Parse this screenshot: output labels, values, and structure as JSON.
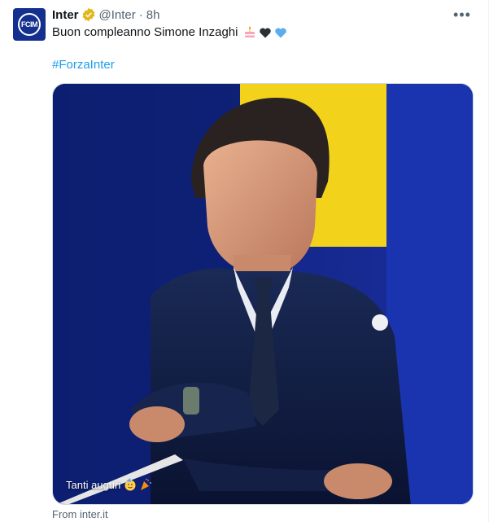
{
  "account": {
    "name": "Inter",
    "handle": "@Inter",
    "separator": "·",
    "time": "8h",
    "avatar_text": "FCIM"
  },
  "tweet": {
    "text": "Buon compleanno Simone Inzaghi",
    "hashtag": "#ForzaInter",
    "emojis": [
      "birthday-cake-icon",
      "black-heart-icon",
      "blue-heart-icon"
    ]
  },
  "media": {
    "caption": "Tanti auguri",
    "caption_emojis": [
      "party-face-icon",
      "party-popper-icon"
    ]
  },
  "card": {
    "source": "From inter.it"
  },
  "colors": {
    "link": "#1d9bf0",
    "muted": "#536471",
    "verified_gold": "#e2b719",
    "inter_blue": "#14308f",
    "yellow": "#f2d21b"
  }
}
